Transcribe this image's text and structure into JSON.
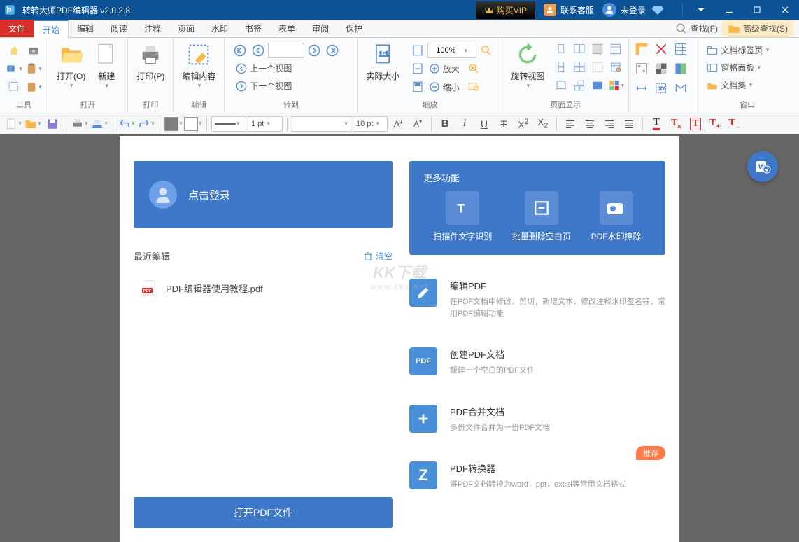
{
  "titlebar": {
    "title": "转转大师PDF编辑器 v2.0.2.8",
    "vip": "购买VIP",
    "kefu": "联系客服",
    "login": "未登录"
  },
  "menu": {
    "file": "文件",
    "tabs": [
      "开始",
      "编辑",
      "阅读",
      "注释",
      "页面",
      "水印",
      "书签",
      "表单",
      "审阅",
      "保护"
    ],
    "search": "查找(F)",
    "advSearch": "高级查找(S)"
  },
  "ribbon": {
    "tool_group": "工具",
    "open_group": "打开",
    "open_btn": "打开(O)",
    "new_btn": "新建",
    "print_group": "打印",
    "print_btn": "打印(P)",
    "edit_group": "编辑",
    "editcontent_btn": "编辑内容",
    "goto_group": "转到",
    "prev_view": "上一个视图",
    "next_view": "下一个视图",
    "actualsize": "实际大小",
    "zoom_group": "缩放",
    "zoomin": "放大",
    "zoomout": "缩小",
    "zoom_value": "100%",
    "rotate": "旋转视图",
    "pagedisplay_group": "页面显示",
    "window_group": "窗口",
    "doc_tab": "文档标签页",
    "panel": "窗格面板",
    "docset": "文档集"
  },
  "toolbar2": {
    "stroke_width": "1 pt",
    "font_size": "10 pt"
  },
  "page": {
    "login_label": "点击登录",
    "recent_title": "最近编辑",
    "clear": "清空",
    "recent_file": "PDF编辑器使用教程.pdf",
    "features_title": "更多功能",
    "features": [
      {
        "name": "扫描件文字识别"
      },
      {
        "name": "批量删除空白页"
      },
      {
        "name": "PDF水印擦除"
      }
    ],
    "actions": [
      {
        "title": "编辑PDF",
        "desc": "在PDF文档中修改，剪切，新增文本，修改注释水印签名等，常用PDF编辑功能"
      },
      {
        "title": "创建PDF文档",
        "desc": "新建一个空白的PDF文件"
      },
      {
        "title": "PDF合并文档",
        "desc": "多份文件合并为一份PDF文档"
      },
      {
        "title": "PDF转换器",
        "desc": "将PDF文档转换为word，ppt，excel等常用文档格式",
        "badge": "推荐"
      }
    ],
    "open_btn": "打开PDF文件"
  },
  "watermark": {
    "main": "KK下载",
    "sub": "www.kkx.net"
  }
}
